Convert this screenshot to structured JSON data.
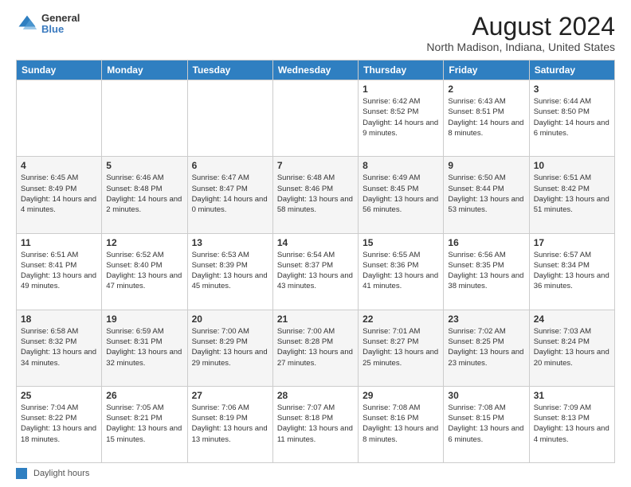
{
  "header": {
    "logo": {
      "general": "General",
      "blue": "Blue"
    },
    "title": "August 2024",
    "subtitle": "North Madison, Indiana, United States"
  },
  "calendar": {
    "days_of_week": [
      "Sunday",
      "Monday",
      "Tuesday",
      "Wednesday",
      "Thursday",
      "Friday",
      "Saturday"
    ],
    "weeks": [
      [
        {
          "day": "",
          "info": ""
        },
        {
          "day": "",
          "info": ""
        },
        {
          "day": "",
          "info": ""
        },
        {
          "day": "",
          "info": ""
        },
        {
          "day": "1",
          "info": "Sunrise: 6:42 AM\nSunset: 8:52 PM\nDaylight: 14 hours and 9 minutes."
        },
        {
          "day": "2",
          "info": "Sunrise: 6:43 AM\nSunset: 8:51 PM\nDaylight: 14 hours and 8 minutes."
        },
        {
          "day": "3",
          "info": "Sunrise: 6:44 AM\nSunset: 8:50 PM\nDaylight: 14 hours and 6 minutes."
        }
      ],
      [
        {
          "day": "4",
          "info": "Sunrise: 6:45 AM\nSunset: 8:49 PM\nDaylight: 14 hours and 4 minutes."
        },
        {
          "day": "5",
          "info": "Sunrise: 6:46 AM\nSunset: 8:48 PM\nDaylight: 14 hours and 2 minutes."
        },
        {
          "day": "6",
          "info": "Sunrise: 6:47 AM\nSunset: 8:47 PM\nDaylight: 14 hours and 0 minutes."
        },
        {
          "day": "7",
          "info": "Sunrise: 6:48 AM\nSunset: 8:46 PM\nDaylight: 13 hours and 58 minutes."
        },
        {
          "day": "8",
          "info": "Sunrise: 6:49 AM\nSunset: 8:45 PM\nDaylight: 13 hours and 56 minutes."
        },
        {
          "day": "9",
          "info": "Sunrise: 6:50 AM\nSunset: 8:44 PM\nDaylight: 13 hours and 53 minutes."
        },
        {
          "day": "10",
          "info": "Sunrise: 6:51 AM\nSunset: 8:42 PM\nDaylight: 13 hours and 51 minutes."
        }
      ],
      [
        {
          "day": "11",
          "info": "Sunrise: 6:51 AM\nSunset: 8:41 PM\nDaylight: 13 hours and 49 minutes."
        },
        {
          "day": "12",
          "info": "Sunrise: 6:52 AM\nSunset: 8:40 PM\nDaylight: 13 hours and 47 minutes."
        },
        {
          "day": "13",
          "info": "Sunrise: 6:53 AM\nSunset: 8:39 PM\nDaylight: 13 hours and 45 minutes."
        },
        {
          "day": "14",
          "info": "Sunrise: 6:54 AM\nSunset: 8:37 PM\nDaylight: 13 hours and 43 minutes."
        },
        {
          "day": "15",
          "info": "Sunrise: 6:55 AM\nSunset: 8:36 PM\nDaylight: 13 hours and 41 minutes."
        },
        {
          "day": "16",
          "info": "Sunrise: 6:56 AM\nSunset: 8:35 PM\nDaylight: 13 hours and 38 minutes."
        },
        {
          "day": "17",
          "info": "Sunrise: 6:57 AM\nSunset: 8:34 PM\nDaylight: 13 hours and 36 minutes."
        }
      ],
      [
        {
          "day": "18",
          "info": "Sunrise: 6:58 AM\nSunset: 8:32 PM\nDaylight: 13 hours and 34 minutes."
        },
        {
          "day": "19",
          "info": "Sunrise: 6:59 AM\nSunset: 8:31 PM\nDaylight: 13 hours and 32 minutes."
        },
        {
          "day": "20",
          "info": "Sunrise: 7:00 AM\nSunset: 8:29 PM\nDaylight: 13 hours and 29 minutes."
        },
        {
          "day": "21",
          "info": "Sunrise: 7:00 AM\nSunset: 8:28 PM\nDaylight: 13 hours and 27 minutes."
        },
        {
          "day": "22",
          "info": "Sunrise: 7:01 AM\nSunset: 8:27 PM\nDaylight: 13 hours and 25 minutes."
        },
        {
          "day": "23",
          "info": "Sunrise: 7:02 AM\nSunset: 8:25 PM\nDaylight: 13 hours and 23 minutes."
        },
        {
          "day": "24",
          "info": "Sunrise: 7:03 AM\nSunset: 8:24 PM\nDaylight: 13 hours and 20 minutes."
        }
      ],
      [
        {
          "day": "25",
          "info": "Sunrise: 7:04 AM\nSunset: 8:22 PM\nDaylight: 13 hours and 18 minutes."
        },
        {
          "day": "26",
          "info": "Sunrise: 7:05 AM\nSunset: 8:21 PM\nDaylight: 13 hours and 15 minutes."
        },
        {
          "day": "27",
          "info": "Sunrise: 7:06 AM\nSunset: 8:19 PM\nDaylight: 13 hours and 13 minutes."
        },
        {
          "day": "28",
          "info": "Sunrise: 7:07 AM\nSunset: 8:18 PM\nDaylight: 13 hours and 11 minutes."
        },
        {
          "day": "29",
          "info": "Sunrise: 7:08 AM\nSunset: 8:16 PM\nDaylight: 13 hours and 8 minutes."
        },
        {
          "day": "30",
          "info": "Sunrise: 7:08 AM\nSunset: 8:15 PM\nDaylight: 13 hours and 6 minutes."
        },
        {
          "day": "31",
          "info": "Sunrise: 7:09 AM\nSunset: 8:13 PM\nDaylight: 13 hours and 4 minutes."
        }
      ]
    ]
  },
  "legend": {
    "label": "Daylight hours"
  }
}
